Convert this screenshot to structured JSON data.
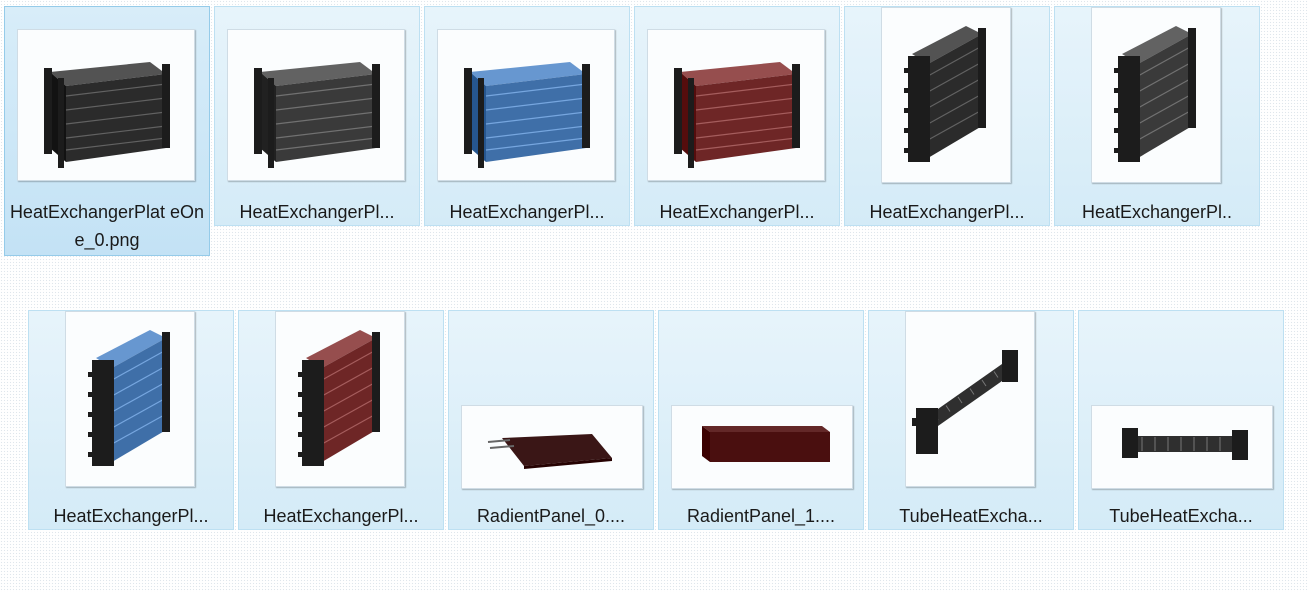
{
  "files": [
    {
      "name": "HeatExchangerPlateOne_0.png",
      "label": "HeatExchangerPlat eOne_0.png",
      "selected": true,
      "thumb": "plate-horizontal",
      "color": "#2b2b2b"
    },
    {
      "name": "HeatExchangerPl...",
      "label": "HeatExchangerPl...",
      "selected": false,
      "thumb": "plate-horizontal",
      "color": "#3a3a3a"
    },
    {
      "name": "HeatExchangerPl...",
      "label": "HeatExchangerPl...",
      "selected": false,
      "thumb": "plate-horizontal",
      "color": "#3f6fa8"
    },
    {
      "name": "HeatExchangerPl...",
      "label": "HeatExchangerPl...",
      "selected": false,
      "thumb": "plate-horizontal",
      "color": "#6e2626"
    },
    {
      "name": "HeatExchangerPl...",
      "label": "HeatExchangerPl...",
      "selected": false,
      "thumb": "plate-vertical",
      "color": "#2b2b2b"
    },
    {
      "name": "HeatExchangerPl...",
      "label": "HeatExchangerPl..",
      "selected": false,
      "thumb": "plate-vertical",
      "color": "#3a3a3a"
    },
    {
      "name": "HeatExchangerPl...",
      "label": "HeatExchangerPl...",
      "selected": false,
      "thumb": "plate-vertical",
      "color": "#3f6fa8"
    },
    {
      "name": "HeatExchangerPl...",
      "label": "HeatExchangerPl...",
      "selected": false,
      "thumb": "plate-vertical",
      "color": "#6e2626"
    },
    {
      "name": "RadientPanel_0....",
      "label": "RadientPanel_0....",
      "selected": false,
      "thumb": "panel-flat",
      "color": "#3a1616"
    },
    {
      "name": "RadientPanel_1....",
      "label": "RadientPanel_1....",
      "selected": false,
      "thumb": "panel-box",
      "color": "#4a0f0f"
    },
    {
      "name": "TubeHeatExcha...",
      "label": "TubeHeatExcha...",
      "selected": false,
      "thumb": "tube-diagonal",
      "color": "#2f2f2f"
    },
    {
      "name": "TubeHeatExcha...",
      "label": "TubeHeatExcha...",
      "selected": false,
      "thumb": "tube-horizontal",
      "color": "#2f2f2f"
    }
  ]
}
